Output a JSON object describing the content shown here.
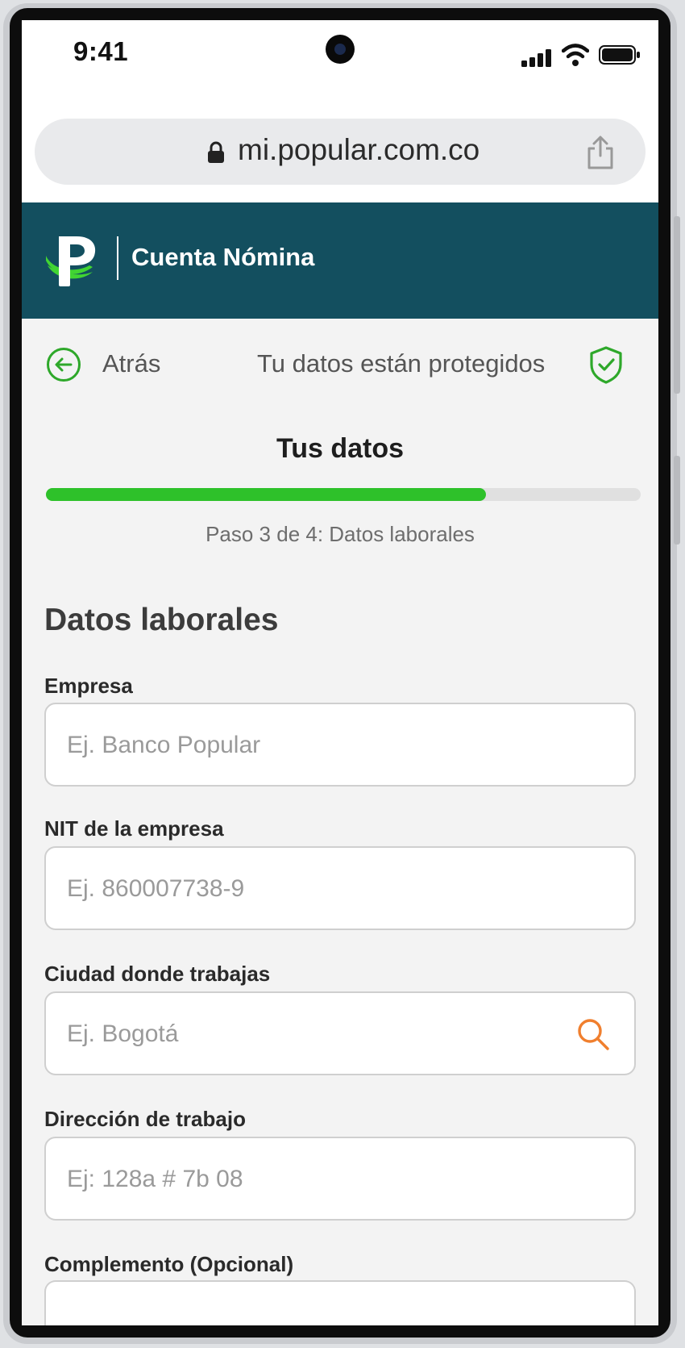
{
  "status_bar": {
    "time": "9:41"
  },
  "browser": {
    "url": "mi.popular.com.co"
  },
  "header": {
    "brand_title": "Cuenta Nómina"
  },
  "nav": {
    "back_label": "Atrás",
    "protected_label": "Tu datos están protegidos"
  },
  "progress": {
    "title": "Tus datos",
    "step_text": "Paso 3 de 4: Datos laborales",
    "value": 0.74
  },
  "form": {
    "section_title": "Datos laborales",
    "fields": [
      {
        "label": "Empresa",
        "placeholder": "Ej. Banco Popular"
      },
      {
        "label": "NIT de la empresa",
        "placeholder": "Ej. 860007738-9"
      },
      {
        "label": "Ciudad donde trabajas",
        "placeholder": "Ej. Bogotá"
      },
      {
        "label": "Dirección de trabajo",
        "placeholder": "Ej: 128a # 7b 08"
      },
      {
        "label": "Complemento (Opcional)"
      }
    ]
  },
  "colors": {
    "header_bg": "#134f5f",
    "accent_green": "#2ec12a",
    "search_orange": "#f07f2e"
  },
  "icons": [
    "lock-icon",
    "share-icon",
    "back-arrow-icon",
    "shield-check-icon",
    "search-icon",
    "brand-logo"
  ]
}
